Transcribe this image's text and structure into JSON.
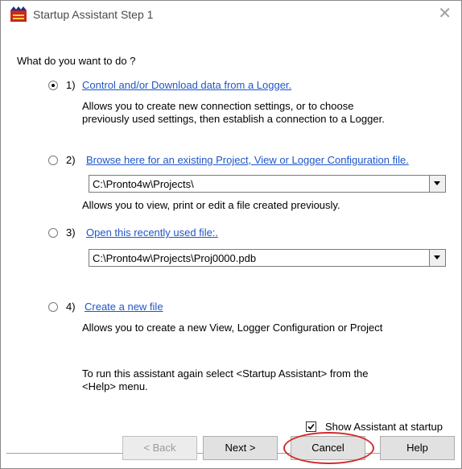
{
  "window": {
    "title": "Startup Assistant Step 1",
    "close_glyph": "✕"
  },
  "question": "What do you want to do ?",
  "options": [
    {
      "number": "1)",
      "checked": true,
      "link": "Control and/or Download data from a Logger.",
      "description": [
        "Allows you to create new connection settings, or to choose",
        "previously used settings, then establish a connection to a Logger."
      ]
    },
    {
      "number": "2)",
      "checked": false,
      "link": "Browse here for an existing Project, View or Logger Configuration file.",
      "combo_value": "C:\\Pronto4w\\Projects\\",
      "description": [
        "Allows you to view, print or edit a file created previously."
      ]
    },
    {
      "number": "3)",
      "checked": false,
      "link": "Open this recently used file:.",
      "combo_value": "C:\\Pronto4w\\Projects\\Proj0000.pdb"
    },
    {
      "number": "4)",
      "checked": false,
      "link": "Create a new file",
      "description": [
        "Allows you to create a new View, Logger Configuration or Project"
      ]
    }
  ],
  "footer_note": [
    "To run this assistant again select <Startup Assistant> from the",
    "<Help> menu."
  ],
  "show_assistant": {
    "label": "Show Assistant at startup",
    "checked": true
  },
  "buttons": {
    "back": "< Back",
    "next": "Next >",
    "cancel": "Cancel",
    "help": "Help"
  },
  "colors": {
    "link": "#1f56c7",
    "highlight": "#d42a2a"
  }
}
